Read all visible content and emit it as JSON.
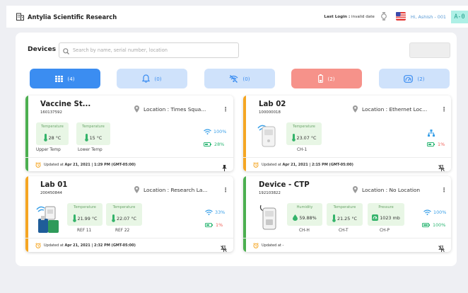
{
  "header": {
    "app_title": "Antylia Scientific Research",
    "last_login_label": "Last Login :",
    "last_login_value": "invalid date",
    "greeting": "Hi, Ashish - 001",
    "avatar_text": "A-0"
  },
  "main": {
    "title": "Devices",
    "search_placeholder": "Search by name, serial number, location"
  },
  "filters": [
    {
      "icon": "grid-icon",
      "count": "(4)",
      "bg": "#3b8df1",
      "fg": "#ffffff"
    },
    {
      "icon": "bell-icon",
      "count": "(0)",
      "bg": "#cfe2fb",
      "fg": "#3b8df1"
    },
    {
      "icon": "wifi-off-icon",
      "count": "(0)",
      "bg": "#cfe2fb",
      "fg": "#3b8df1"
    },
    {
      "icon": "battery-icon",
      "count": "(2)",
      "bg": "#f6928a",
      "fg": "#ffffff"
    },
    {
      "icon": "gauge-icon",
      "count": "(2)",
      "bg": "#cfe2fb",
      "fg": "#3b8df1"
    }
  ],
  "devices": [
    {
      "name": "Vaccine St...",
      "serial": "160137592",
      "location": "Location : Times Squa...",
      "stripe": "#4caf50",
      "sensors": [
        {
          "label": "Temperature",
          "value": "28 °C",
          "sub": "Upper Temp"
        },
        {
          "label": "Temperature",
          "value": "15 °C",
          "sub": "Lower Temp"
        }
      ],
      "signal": "100%",
      "battery": "28%",
      "battery_color": "#2bb673",
      "updated_prefix": "Updated at",
      "updated_value": "Apr 21, 2021 | 1:29 PM (GMT-05:00)"
    },
    {
      "name": "Lab 02",
      "serial": "100000018",
      "location": "Location : Ethernet Loc...",
      "stripe": "#f5a623",
      "sensors": [
        {
          "label": "Temperature",
          "value": "23.07 °C",
          "sub": "CH-1"
        }
      ],
      "battery": "1%",
      "battery_color": "#f0625a",
      "updated_prefix": "Updated at",
      "updated_value": "Apr 21, 2021 | 2:15 PM (GMT-05:00)"
    },
    {
      "name": "Lab 01",
      "serial": "200450844",
      "location": "Location : Research La...",
      "stripe": "#f5a623",
      "sensors": [
        {
          "label": "Temperature",
          "value": "21.99 °C",
          "sub": "REF 11"
        },
        {
          "label": "Temperature",
          "value": "22.07 °C",
          "sub": "REF 22"
        }
      ],
      "signal": "33%",
      "battery": "1%",
      "battery_color": "#f0625a",
      "updated_prefix": "Updated at",
      "updated_value": "Apr 21, 2021 | 2:32 PM (GMT-05:00)"
    },
    {
      "name": "Device - CTP",
      "serial": "192103822",
      "location": "Location : No Location",
      "stripe": "#4caf50",
      "sensors": [
        {
          "label": "Humidity",
          "value": "59.88%",
          "sub": "CH-H"
        },
        {
          "label": "Temperature",
          "value": "21.25 °C",
          "sub": "CH-T"
        },
        {
          "label": "Pressure",
          "value": "1023 mb",
          "sub": "CH-P"
        }
      ],
      "signal": "100%",
      "battery": "100%",
      "battery_color": "#2bb673",
      "updated_prefix": "Updated at -",
      "updated_value": ""
    }
  ]
}
